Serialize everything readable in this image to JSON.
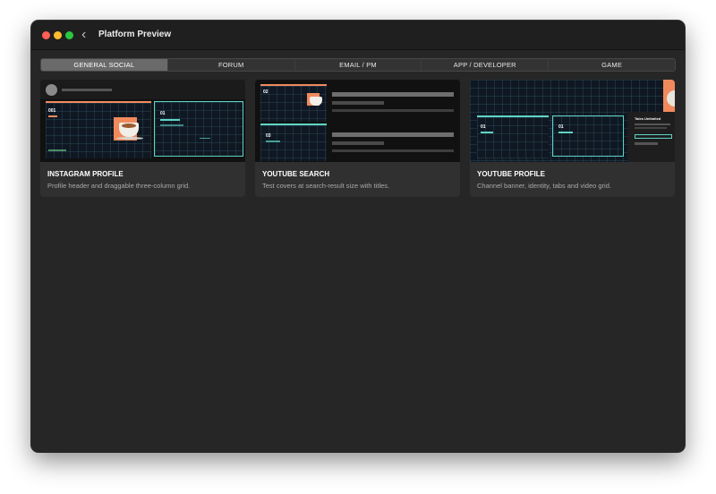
{
  "window": {
    "title": "Platform Preview"
  },
  "tabs": [
    {
      "label": "GENERAL SOCIAL",
      "active": true
    },
    {
      "label": "FORUM",
      "active": false
    },
    {
      "label": "EMAIL / PM",
      "active": false
    },
    {
      "label": "APP / DEVELOPER",
      "active": false
    },
    {
      "label": "GAME",
      "active": false
    }
  ],
  "cards": [
    {
      "title": "INSTAGRAM PROFILE",
      "description": "Profile header and draggable three-column grid.",
      "thumb_labels": {
        "a": "001",
        "b": "01"
      }
    },
    {
      "title": "YOUTUBE SEARCH",
      "description": "Test covers at search-result size with titles.",
      "thumb_labels": {
        "a": "02",
        "b": "03"
      }
    },
    {
      "title": "YOUTUBE PROFILE",
      "description": "Channel banner, identity, tabs and video grid.",
      "thumb_labels": {
        "a": "01",
        "b": "01",
        "c": "Tales Unlimited"
      }
    }
  ],
  "colors": {
    "accent_orange": "#f08a5d",
    "accent_teal": "#5fd4c4",
    "active_tab": "#6a6a6a"
  }
}
